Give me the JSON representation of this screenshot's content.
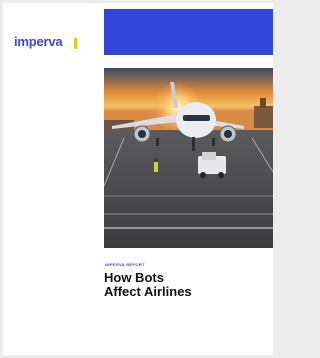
{
  "brand": {
    "name": "imperva",
    "accent_color": "#3846d8",
    "mark_color": "#f2c40e"
  },
  "report": {
    "label": "IMPERVA REPORT",
    "title_line1": "How Bots",
    "title_line2": "Affect Airlines"
  },
  "colors": {
    "band": "#3346db",
    "title": "#111111"
  }
}
